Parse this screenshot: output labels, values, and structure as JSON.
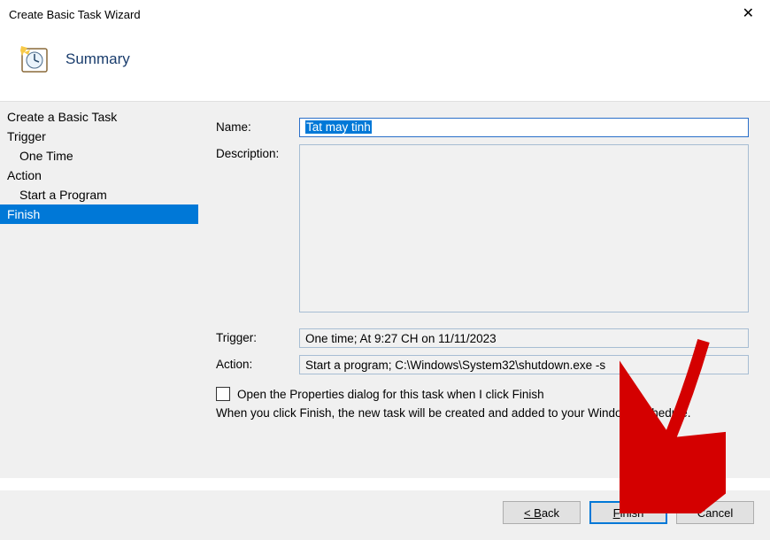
{
  "window": {
    "title": "Create Basic Task Wizard"
  },
  "header": {
    "title": "Summary"
  },
  "sidebar": {
    "items": [
      {
        "label": "Create a Basic Task",
        "indent": 0
      },
      {
        "label": "Trigger",
        "indent": 0
      },
      {
        "label": "One Time",
        "indent": 1
      },
      {
        "label": "Action",
        "indent": 0
      },
      {
        "label": "Start a Program",
        "indent": 1
      },
      {
        "label": "Finish",
        "indent": 0,
        "active": true
      }
    ]
  },
  "form": {
    "name_label": "Name:",
    "name_value": "Tat may tinh",
    "desc_label": "Description:",
    "desc_value": "",
    "trigger_label": "Trigger:",
    "trigger_value": "One time; At 9:27 CH on 11/11/2023",
    "action_label": "Action:",
    "action_value": "Start a program; C:\\Windows\\System32\\shutdown.exe -s",
    "checkbox_label": "Open the Properties dialog for this task when I click Finish",
    "hint": "When you click Finish, the new task will be created and added to your Windows schedule."
  },
  "buttons": {
    "back": "< Back",
    "finish_pre": "F",
    "finish_post": "inish",
    "cancel": "Cancel"
  }
}
